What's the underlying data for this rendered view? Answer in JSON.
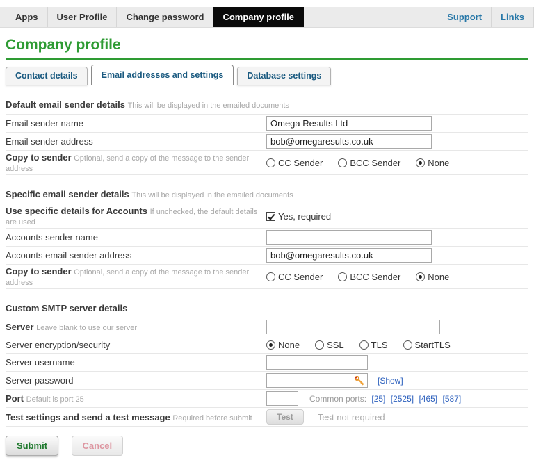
{
  "nav": {
    "items": [
      "Apps",
      "User Profile",
      "Change password",
      "Company profile"
    ],
    "active_item": "Company profile",
    "right_items": [
      "Support",
      "Links"
    ]
  },
  "page_title": "Company profile",
  "tabs": {
    "contact": "Contact details",
    "email": "Email addresses and settings",
    "database": "Database settings",
    "active": "Email addresses and settings"
  },
  "default_sender": {
    "heading": "Default email sender details",
    "hint": "This will be displayed in the emailed documents",
    "email_sender_name": {
      "label": "Email sender name",
      "value": "Omega Results Ltd"
    },
    "email_sender_address": {
      "label": "Email sender address",
      "value": "bob@omegaresults.co.uk"
    },
    "copy_to_sender": {
      "label": "Copy to sender",
      "hint": "Optional, send a copy of the message to the sender address",
      "options": [
        "CC Sender",
        "BCC Sender",
        "None"
      ],
      "selected": "None"
    }
  },
  "specific_sender": {
    "heading": "Specific email sender details",
    "hint": "This will be displayed in the emailed documents",
    "use_specific": {
      "label": "Use specific details for Accounts",
      "hint": "If unchecked, the default details are used",
      "checkbox_label": "Yes, required",
      "checked": true
    },
    "accounts_sender_name": {
      "label": "Accounts sender name",
      "value": ""
    },
    "accounts_email_sender_address": {
      "label": "Accounts email sender address",
      "value": "bob@omegaresults.co.uk"
    },
    "copy_to_sender": {
      "label": "Copy to sender",
      "hint": "Optional, send a copy of the message to the sender address",
      "options": [
        "CC Sender",
        "BCC Sender",
        "None"
      ],
      "selected": "None"
    }
  },
  "smtp": {
    "heading": "Custom SMTP server details",
    "server": {
      "label": "Server",
      "hint": "Leave blank to use our server",
      "value": ""
    },
    "encryption": {
      "label": "Server encryption/security",
      "options": [
        "None",
        "SSL",
        "TLS",
        "StartTLS"
      ],
      "selected": "None"
    },
    "username": {
      "label": "Server username",
      "value": ""
    },
    "password": {
      "label": "Server password",
      "value": "",
      "show_link": "[Show]",
      "icon": "key-icon"
    },
    "port": {
      "label": "Port",
      "hint": "Default is port 25",
      "value": "",
      "common_ports_label": "Common ports:",
      "common_ports": [
        "[25]",
        "[2525]",
        "[465]",
        "[587]"
      ]
    },
    "test": {
      "label": "Test settings and send a test message",
      "hint": "Required before submit",
      "button_label": "Test",
      "status": "Test not required"
    }
  },
  "actions": {
    "submit_label": "Submit",
    "cancel_label": "Cancel"
  },
  "colors": {
    "accent_green": "#2e9b33",
    "tab_blue": "#1a5a80",
    "nav_link_blue": "#2878a8",
    "link_blue": "#2b5fbd",
    "nav_active_bg": "#0a0a0a"
  }
}
